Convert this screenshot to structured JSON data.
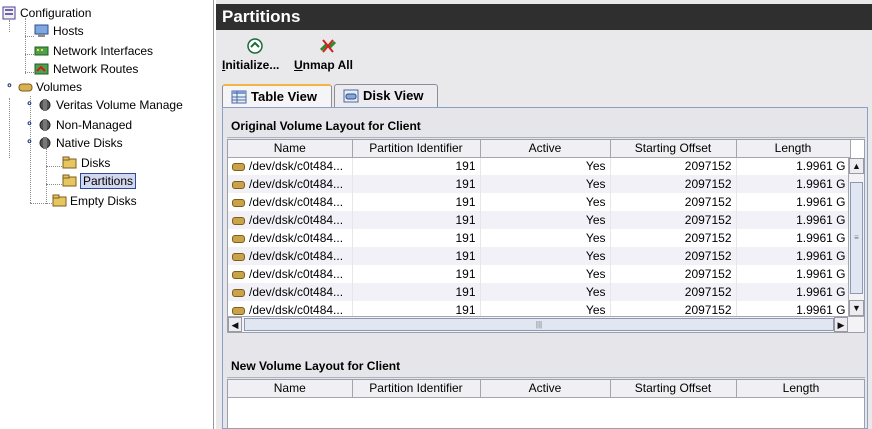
{
  "tree": {
    "items": [
      {
        "label": "Configuration",
        "icon": "configuration-icon"
      },
      {
        "label": "Hosts",
        "icon": "host-icon"
      },
      {
        "label": "Network Interfaces",
        "icon": "network-interface-icon"
      },
      {
        "label": "Network Routes",
        "icon": "network-route-icon"
      },
      {
        "label": "Volumes",
        "icon": "volume-icon"
      },
      {
        "label": "Veritas Volume Manage",
        "icon": "volume-manager-icon"
      },
      {
        "label": "Non-Managed",
        "icon": "volume-manager-icon"
      },
      {
        "label": "Native Disks",
        "icon": "volume-manager-icon"
      },
      {
        "label": "Disks",
        "icon": "disk-folder-icon"
      },
      {
        "label": "Partitions",
        "icon": "disk-folder-icon",
        "selected": true
      },
      {
        "label": "Empty Disks",
        "icon": "disk-folder-icon"
      }
    ]
  },
  "panel": {
    "title": "Partitions"
  },
  "toolbar": {
    "initialize_label": "Initialize...",
    "initialize_mnemonic": "I",
    "initialize_rest": "nitialize...",
    "unmap_label": "Unmap All",
    "unmap_mnemonic": "U",
    "unmap_rest": "nmap All"
  },
  "tabs": [
    {
      "label": "Table View",
      "active": true
    },
    {
      "label": "Disk View",
      "active": false
    }
  ],
  "original": {
    "header": "Original Volume Layout for Client",
    "columns": [
      "Name",
      "Partition Identifier",
      "Active",
      "Starting Offset",
      "Length"
    ],
    "rows": [
      [
        "/dev/dsk/c0t484...",
        "191",
        "Yes",
        "2097152",
        "1.9961 G"
      ],
      [
        "/dev/dsk/c0t484...",
        "191",
        "Yes",
        "2097152",
        "1.9961 G"
      ],
      [
        "/dev/dsk/c0t484...",
        "191",
        "Yes",
        "2097152",
        "1.9961 G"
      ],
      [
        "/dev/dsk/c0t484...",
        "191",
        "Yes",
        "2097152",
        "1.9961 G"
      ],
      [
        "/dev/dsk/c0t484...",
        "191",
        "Yes",
        "2097152",
        "1.9961 G"
      ],
      [
        "/dev/dsk/c0t484...",
        "191",
        "Yes",
        "2097152",
        "1.9961 G"
      ],
      [
        "/dev/dsk/c0t484...",
        "191",
        "Yes",
        "2097152",
        "1.9961 G"
      ],
      [
        "/dev/dsk/c0t484...",
        "191",
        "Yes",
        "2097152",
        "1.9961 G"
      ],
      [
        "/dev/dsk/c0t484...",
        "191",
        "Yes",
        "2097152",
        "1.9961 G"
      ]
    ]
  },
  "new_layout": {
    "header": "New Volume Layout for Client",
    "columns": [
      "Name",
      "Partition Identifier",
      "Active",
      "Starting Offset",
      "Length"
    ]
  },
  "colors": {
    "title_bar": "#2f2f2f",
    "active_tab_accent": "#f4b548",
    "selection": "#d4d8ee"
  }
}
